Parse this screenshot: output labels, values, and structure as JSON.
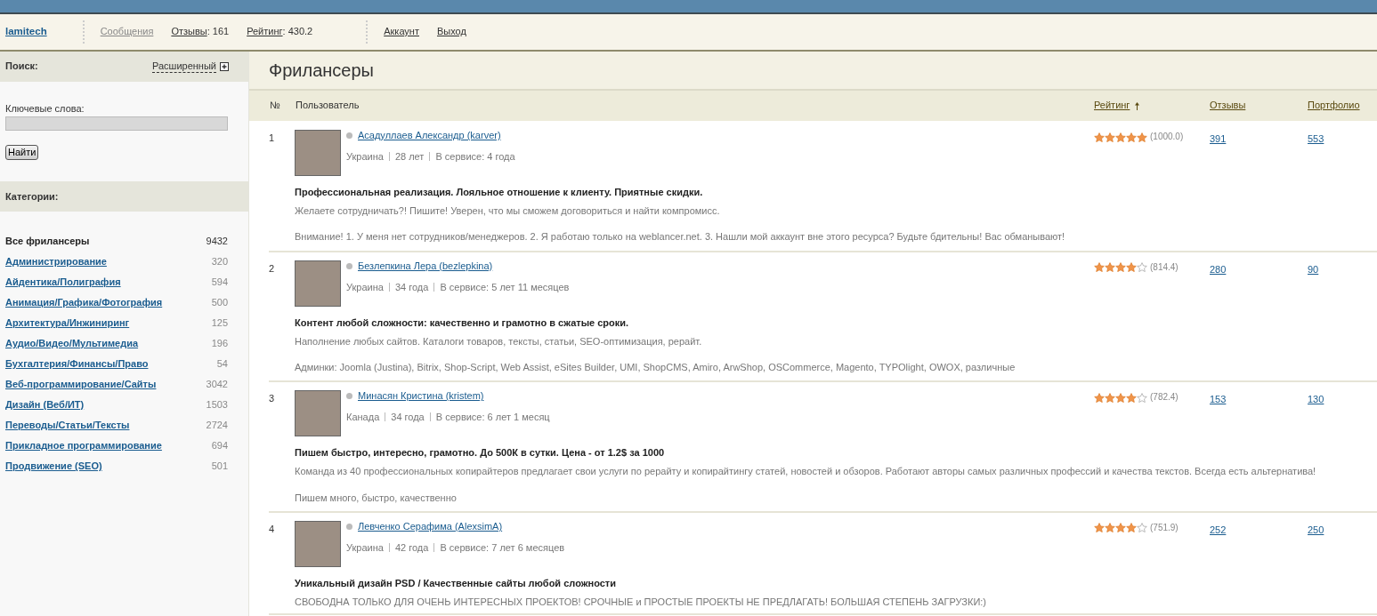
{
  "user_bar": {
    "username": "lamitech",
    "items": [
      {
        "kind": "link",
        "label": "Сообщения",
        "disabled": true
      },
      {
        "kind": "stat",
        "label": "Отзывы",
        "value": ": 161"
      },
      {
        "kind": "stat",
        "label": "Рейтинг",
        "value": ": 430.2"
      },
      {
        "kind": "link",
        "label": "Аккаунт",
        "disabled": false
      },
      {
        "kind": "link",
        "label": "Выход",
        "disabled": false
      }
    ]
  },
  "sidebar": {
    "search": {
      "title": "Поиск:",
      "advanced": "Расширенный",
      "keywords_label": "Ключевые слова:",
      "button": "Найти"
    },
    "categories_title": "Категории:",
    "categories": [
      {
        "label": "Все фрилансеры",
        "count": "9432",
        "selected": true
      },
      {
        "label": "Администрирование",
        "count": "320",
        "selected": false
      },
      {
        "label": "Айдентика/Полиграфия",
        "count": "594",
        "selected": false
      },
      {
        "label": "Анимация/Графика/Фотография",
        "count": "500",
        "selected": false
      },
      {
        "label": "Архитектура/Инжиниринг",
        "count": "125",
        "selected": false
      },
      {
        "label": "Аудио/Видео/Мультимедиа",
        "count": "196",
        "selected": false
      },
      {
        "label": "Бухгалтерия/Финансы/Право",
        "count": "54",
        "selected": false
      },
      {
        "label": "Веб-программирование/Сайты",
        "count": "3042",
        "selected": false
      },
      {
        "label": "Дизайн (Веб/ИТ)",
        "count": "1503",
        "selected": false
      },
      {
        "label": "Переводы/Статьи/Тексты",
        "count": "2724",
        "selected": false
      },
      {
        "label": "Прикладное программирование",
        "count": "694",
        "selected": false
      },
      {
        "label": "Продвижение (SEO)",
        "count": "501",
        "selected": false
      }
    ]
  },
  "main": {
    "title": "Фрилансеры",
    "table": {
      "columns": [
        "№",
        "Пользователь",
        "Рейтинг",
        "Отзывы",
        "Портфолио"
      ],
      "rows": [
        {
          "number": "1",
          "name": "Асадуллаев Александр (karver)",
          "online": false,
          "country": "Украина",
          "age": "28 лет",
          "service": "В сервисе: 4 года",
          "headline": "Профессиональная реализация. Лояльное отношение к клиенту. Приятные скидки.",
          "description": "Желаете сотрудничать?! Пишите! Уверен, что мы сможем договориться и найти компромисс.",
          "note": "Внимание! 1. У меня нет сотрудников/менеджеров. 2. Я работаю только на weblancer.net. 3. Нашли мой аккаунт вне этого ресурса? Будьте бдительны! Вас обманывают!",
          "stars": 5,
          "score": "(1000.0)",
          "reviews": "391",
          "portfolio": "553"
        },
        {
          "number": "2",
          "name": "Безлепкина Лера (bezlepkina)",
          "online": false,
          "country": "Украина",
          "age": "34 года",
          "service": "В сервисе: 5 лет 11 месяцев",
          "headline": "Контент любой сложности: качественно и грамотно в сжатые сроки.",
          "description": "Наполнение любых сайтов. Каталоги товаров, тексты, статьи, SEO-оптимизация, рерайт.",
          "note": "Админки: Joomla (Justina), Bitrix, Shop-Script, Web Assist, eSites Builder, UMI, ShopCMS, Amiro, ArwShop, OSCommerce, Magento, TYPOlight, OWOX, различные",
          "stars": 4,
          "score": "(814.4)",
          "reviews": "280",
          "portfolio": "90"
        },
        {
          "number": "3",
          "name": "Минасян Кристина (kristem)",
          "online": false,
          "country": "Канада",
          "age": "34 года",
          "service": "В сервисе: 6 лет 1 месяц",
          "headline": "Пишем быстро, интересно, грамотно. До 500К в сутки. Цена - от 1.2$ за 1000",
          "description": "Команда из 40 профессиональных копирайтеров предлагает свои услуги по рерайту и копирайтингу статей, новостей и обзоров. Работают авторы самых различных профессий и качества текстов. Всегда есть альтернатива!",
          "note": "Пишем много, быстро, качественно",
          "stars": 4,
          "score": "(782.4)",
          "reviews": "153",
          "portfolio": "130"
        },
        {
          "number": "4",
          "name": "Левченко Серафима (AlexsimA)",
          "online": false,
          "country": "Украина",
          "age": "42 года",
          "service": "В сервисе: 7 лет 6 месяцев",
          "headline": "Уникальный дизайн PSD / Качественные сайты любой сложности",
          "description": "СВОБОДНА ТОЛЬКО ДЛЯ ОЧЕНЬ ИНТЕРЕСНЫХ ПРОЕКТОВ! СРОЧНЫЕ и ПРОСТЫЕ ПРОЕКТЫ НЕ ПРЕДЛАГАТЬ! БОЛЬШАЯ СТЕПЕНЬ ЗАГРУЗКИ:)",
          "stars": 4,
          "score": "(751.9)",
          "reviews": "252",
          "portfolio": "250"
        }
      ]
    }
  }
}
